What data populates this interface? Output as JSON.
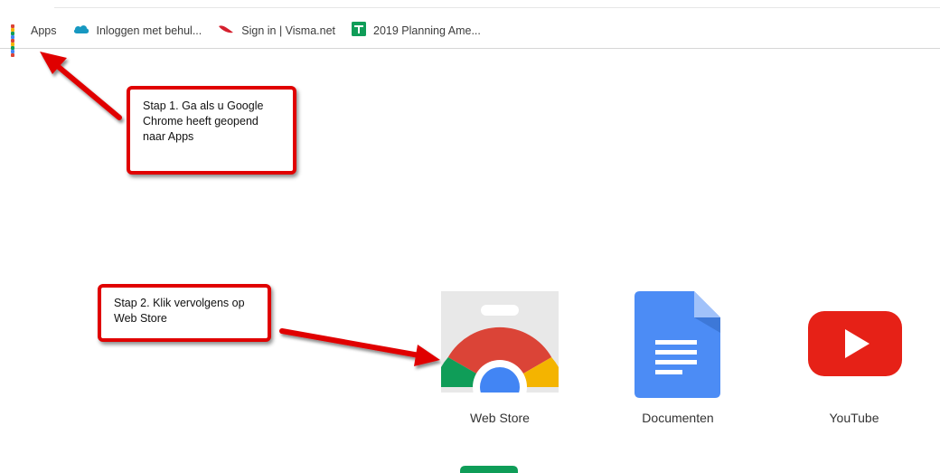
{
  "bookmarks": [
    {
      "label": "Apps",
      "icon": "apps-grid-icon"
    },
    {
      "label": "Inloggen met behul...",
      "icon": "cloud-icon"
    },
    {
      "label": "Sign in | Visma.net",
      "icon": "visma-icon"
    },
    {
      "label": "2019 Planning Ame...",
      "icon": "sheets-icon"
    }
  ],
  "callouts": {
    "step1": "Stap 1. Ga als u Google Chrome heeft geopend naar Apps",
    "step2": "Stap 2. Klik vervolgens op Web Store"
  },
  "apps": {
    "webstore": "Web Store",
    "docs": "Documenten",
    "youtube": "YouTube"
  },
  "colors": {
    "annotation_red": "#e00000",
    "docs_blue": "#4c8cf5",
    "youtube_red": "#e62117",
    "chrome_red": "#db4437",
    "chrome_green": "#0f9d58",
    "chrome_yellow": "#f4b400",
    "chrome_blue": "#4285f4"
  }
}
